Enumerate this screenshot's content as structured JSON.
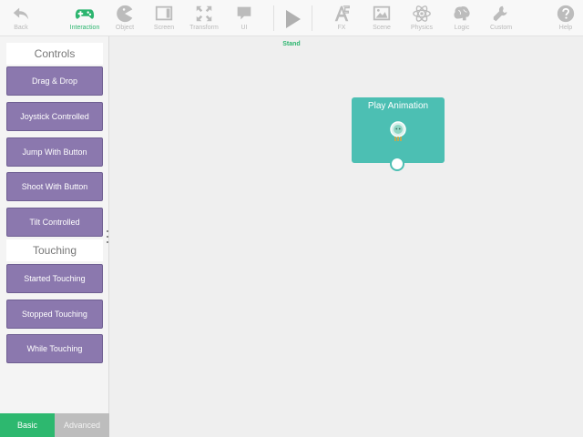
{
  "toolbar": {
    "back": {
      "label": "Back",
      "icon": "back-arrow-icon"
    },
    "items": [
      {
        "label": "Interaction",
        "icon": "gamepad-icon",
        "active": true
      },
      {
        "label": "Object",
        "icon": "pacman-icon"
      },
      {
        "label": "Screen",
        "icon": "screen-icon"
      },
      {
        "label": "Transform",
        "icon": "expand-icon"
      },
      {
        "label": "UI",
        "icon": "speech-bubble-icon"
      }
    ],
    "play": {
      "icon": "play-icon",
      "caption": "Stand"
    },
    "items_right": [
      {
        "label": "FX",
        "icon": "fx-icon"
      },
      {
        "label": "Scene",
        "icon": "image-icon"
      },
      {
        "label": "Physics",
        "icon": "atom-icon"
      },
      {
        "label": "Logic",
        "icon": "brain-icon"
      },
      {
        "label": "Custom",
        "icon": "wrench-icon"
      }
    ],
    "help": {
      "label": "Help",
      "icon": "help-icon"
    }
  },
  "sidebar": {
    "sections": [
      {
        "title": "Controls",
        "items": [
          "Drag & Drop",
          "Joystick Controlled",
          "Jump With Button",
          "Shoot With Button",
          "Tilt Controlled"
        ]
      },
      {
        "title": "Touching",
        "items": [
          "Started Touching",
          "Stopped Touching",
          "While Touching"
        ]
      }
    ],
    "tabs": {
      "basic": "Basic",
      "advanced": "Advanced"
    }
  },
  "canvas": {
    "block": {
      "title": "Play Animation"
    }
  },
  "colors": {
    "accent": "#2cb56f",
    "block_purple": "#8b78ae",
    "block_teal": "#4cbfb3"
  }
}
